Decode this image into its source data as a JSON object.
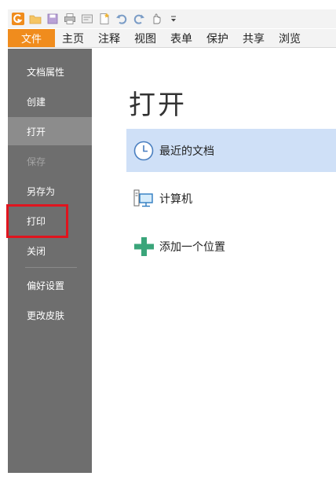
{
  "ribbon": {
    "tabs": [
      {
        "label": "文件",
        "active": true
      },
      {
        "label": "主页"
      },
      {
        "label": "注释"
      },
      {
        "label": "视图"
      },
      {
        "label": "表单"
      },
      {
        "label": "保护"
      },
      {
        "label": "共享"
      },
      {
        "label": "浏览"
      }
    ]
  },
  "quick_access": {
    "icons": [
      "app-logo-icon",
      "open-folder-icon",
      "save-icon",
      "print-icon",
      "scan-icon",
      "new-icon",
      "undo-icon",
      "redo-icon",
      "hand-tool-icon",
      "customize-dropdown-icon"
    ]
  },
  "sidebar": {
    "items": [
      {
        "label": "文档属性"
      },
      {
        "label": "创建"
      },
      {
        "label": "打开",
        "selected": true
      },
      {
        "label": "保存",
        "disabled": true
      },
      {
        "label": "另存为"
      },
      {
        "label": "打印",
        "highlighted": true
      },
      {
        "label": "关闭"
      },
      {
        "label": "偏好设置"
      },
      {
        "label": "更改皮肤"
      }
    ]
  },
  "main": {
    "title": "打开",
    "options": [
      {
        "label": "最近的文档",
        "icon": "clock-icon",
        "selected": true
      },
      {
        "label": "计算机",
        "icon": "computer-icon"
      },
      {
        "label": "添加一个位置",
        "icon": "plus-icon"
      }
    ]
  },
  "colors": {
    "file_tab": "#f08c1d",
    "sidebar_bg": "#6e6e6e",
    "sidebar_selected": "#8c8c8c",
    "selected_option_bg": "#cfe0f7",
    "highlight_border": "#e0141e",
    "plus_icon": "#3aa57a"
  }
}
